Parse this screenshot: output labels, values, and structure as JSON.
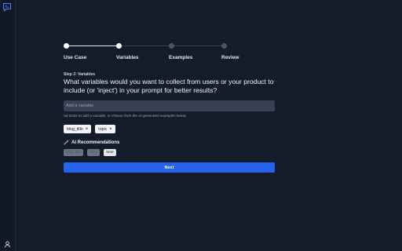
{
  "steps": [
    {
      "label": "Use Case",
      "state": "complete"
    },
    {
      "label": "Variables",
      "state": "current"
    },
    {
      "label": "Examples",
      "state": "pending"
    },
    {
      "label": "Review",
      "state": "pending"
    }
  ],
  "form": {
    "kicker": "Step 2: Variables",
    "question": "What variables would you want to collect from users or your product to include (or 'inject') in your prompt for better results?",
    "input_placeholder": "Add a variable",
    "input_value": "",
    "hint": "Hit Enter to add a variable, or choose from the AI-generated examples below."
  },
  "selected_variables": [
    {
      "label": "blog_title",
      "remove": "×"
    },
    {
      "label": "topic",
      "remove": "×"
    }
  ],
  "ai": {
    "heading": "AI Recommendations",
    "icon": "magic-wand-icon",
    "recommendations": [
      {
        "label": "blog_title",
        "added": true
      },
      {
        "label": "topic",
        "added": true
      },
      {
        "label": "tone",
        "added": false
      }
    ]
  },
  "next_label": "Next",
  "icons": {
    "logo": "prompt-terminal-icon",
    "user": "user-icon"
  },
  "colors": {
    "background": "#141b2b",
    "accent": "#2563eb"
  }
}
